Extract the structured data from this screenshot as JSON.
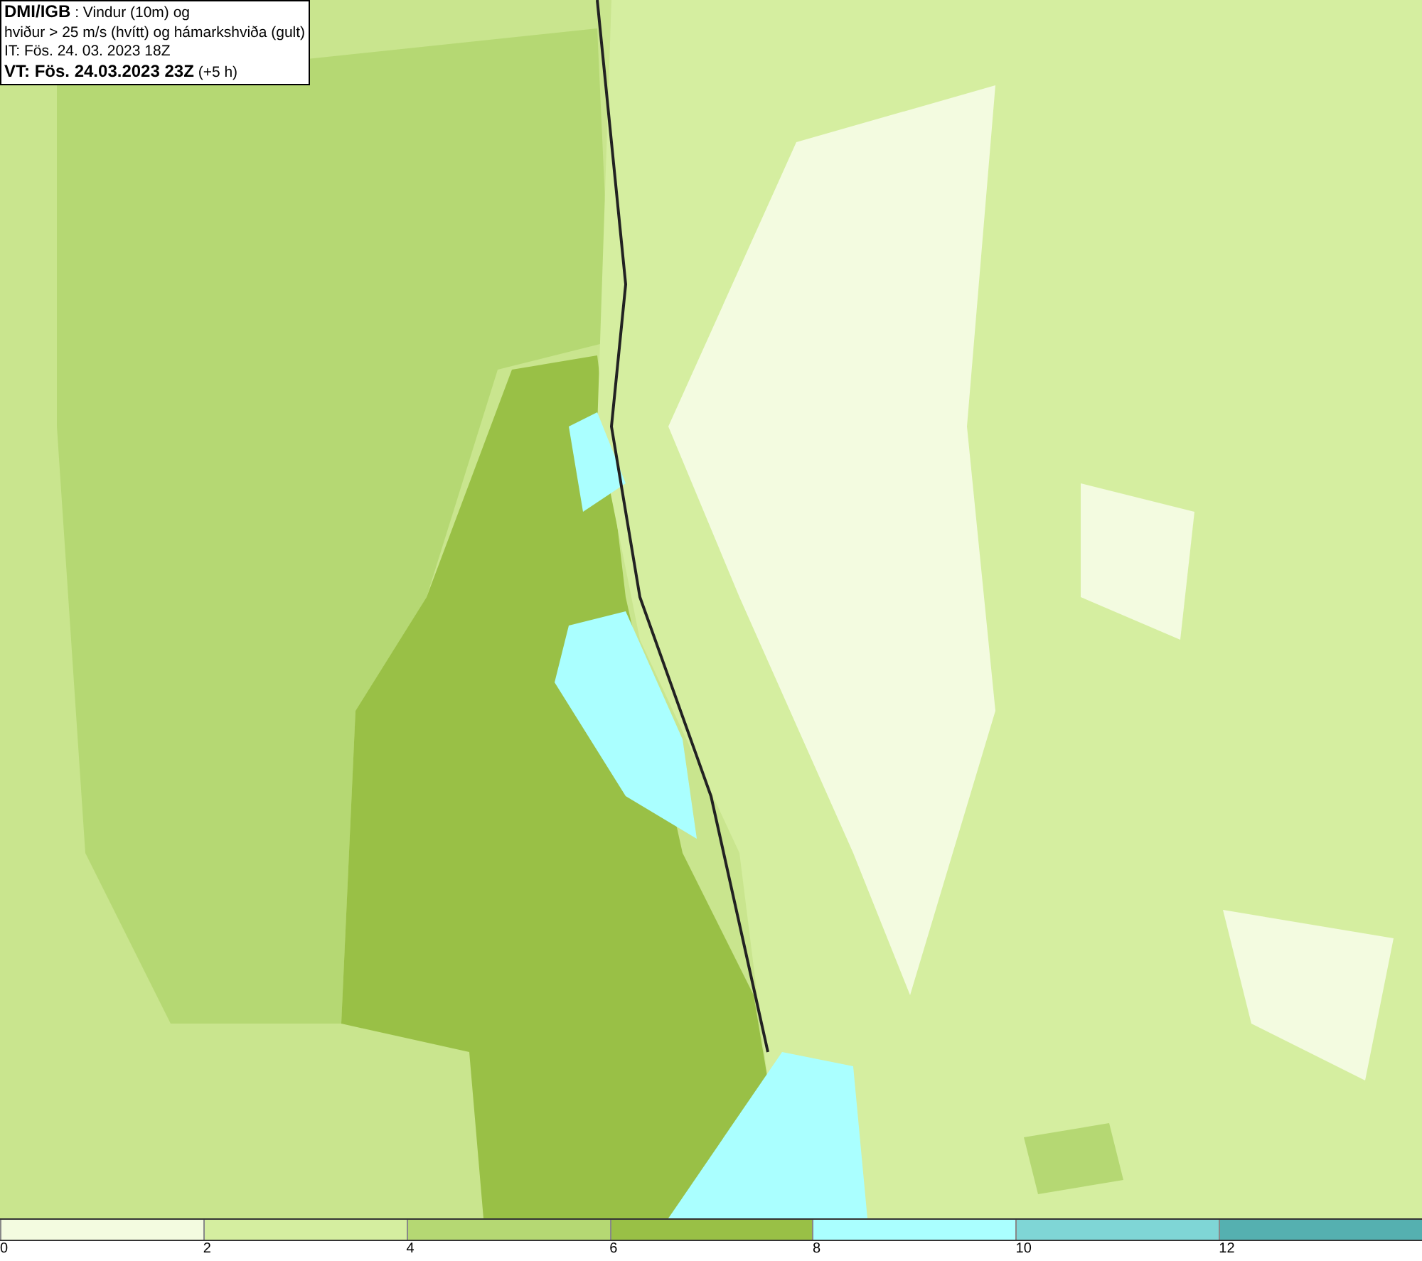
{
  "info_box": {
    "lines": [
      "**DMI/IGB** : Vindur (10m) og",
      "hviður > 25 m/s (hvítt) og hámarkshviða (gult)",
      "IT: Fös. 24. 03. 2023 18Z",
      "**VT: Fös. 24.03.2023 23Z** (+5 h)"
    ]
  },
  "legend": [
    {
      "label": "0",
      "color": "#f3fbe0"
    },
    {
      "label": "2",
      "color": "#d5eea0"
    },
    {
      "label": "4",
      "color": "#b5d873"
    },
    {
      "label": "6",
      "color": "#99c046"
    },
    {
      "label": "8",
      "color": "#aaffff"
    },
    {
      "label": "10",
      "color": "#7fd6d6"
    },
    {
      "label": "12",
      "color": "#55b0b0"
    }
  ]
}
